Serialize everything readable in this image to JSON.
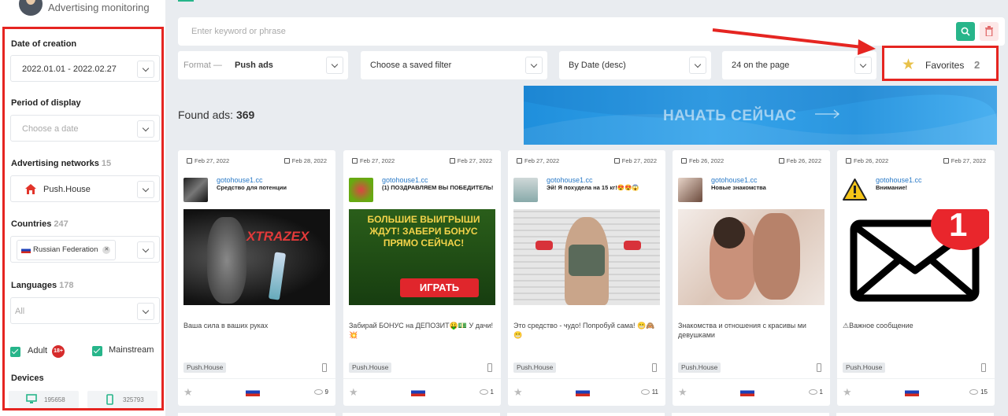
{
  "app": {
    "subtitle": "Advertising monitoring"
  },
  "filters": {
    "date_of_creation": {
      "label": "Date of creation",
      "value": "2022.01.01 - 2022.02.27"
    },
    "period_of_display": {
      "label": "Period of display",
      "placeholder": "Choose a date"
    },
    "advertising_networks": {
      "label": "Advertising networks",
      "count": "15",
      "value": "Push.House"
    },
    "countries": {
      "label": "Countries",
      "count": "247",
      "chip": "Russian Federation"
    },
    "languages": {
      "label": "Languages",
      "count": "178",
      "value": "All"
    },
    "adult": {
      "label": "Adult",
      "badge": "18+"
    },
    "mainstream": {
      "label": "Mainstream"
    },
    "devices": {
      "label": "Devices",
      "desktop_count": "195658",
      "mobile_count": "325793"
    }
  },
  "search": {
    "placeholder": "Enter keyword or phrase"
  },
  "toolbar": {
    "format_label": "Format —",
    "format_value": "Push ads",
    "saved_filter": "Choose a saved filter",
    "sort": "By Date (desc)",
    "per_page": "24 on the page",
    "favorites_label": "Favorites",
    "favorites_count": "2"
  },
  "results": {
    "found_label": "Found ads:",
    "found_count": "369"
  },
  "banner": {
    "text": "НАЧАТЬ СЕЙЧАС"
  },
  "colors": {
    "accent": "#27b58a",
    "highlight": "#e52521",
    "link": "#2a7ac7"
  },
  "cards": [
    {
      "date_start": "Feb 27, 2022",
      "date_end": "Feb 28, 2022",
      "domain": "gotohouse1.cc",
      "title": "Средство для потенции",
      "image_text": "XTRAZEX",
      "description": "Ваша сила в ваших руках",
      "network": "Push.House",
      "views": "9"
    },
    {
      "date_start": "Feb 27, 2022",
      "date_end": "Feb 27, 2022",
      "domain": "gotohouse1.cc",
      "title": "(1) ПОЗДРАВЛЯЕМ ВЫ ПОБЕДИТЕЛЬ!",
      "image_text": "БОЛЬШИЕ ВЫИГРЫШИ ЖДУТ! ЗАБЕРИ БОНУС ПРЯМО СЕЙЧАС!",
      "image_button": "ИГРАТЬ",
      "description": "Забирай БОНУС на ДЕПОЗИТ🤑💵 У дачи!💥",
      "network": "Push.House",
      "views": "1"
    },
    {
      "date_start": "Feb 27, 2022",
      "date_end": "Feb 27, 2022",
      "domain": "gotohouse1.cc",
      "title": "Эй! Я похудела на 15 кг!😍😍😱",
      "description": "Это средство - чудо! Попробуй сама! 😬🙈😬",
      "network": "Push.House",
      "views": "11"
    },
    {
      "date_start": "Feb 26, 2022",
      "date_end": "Feb 26, 2022",
      "domain": "gotohouse1.cc",
      "title": "Новые знакомства",
      "description": "Знакомства и отношения с красивы ми девушками",
      "network": "Push.House",
      "views": "1"
    },
    {
      "date_start": "Feb 26, 2022",
      "date_end": "Feb 27, 2022",
      "domain": "gotohouse1.cc",
      "title": "Внимание!",
      "image_badge": "1",
      "description": "⚠Важное сообщение",
      "network": "Push.House",
      "views": "15"
    }
  ]
}
